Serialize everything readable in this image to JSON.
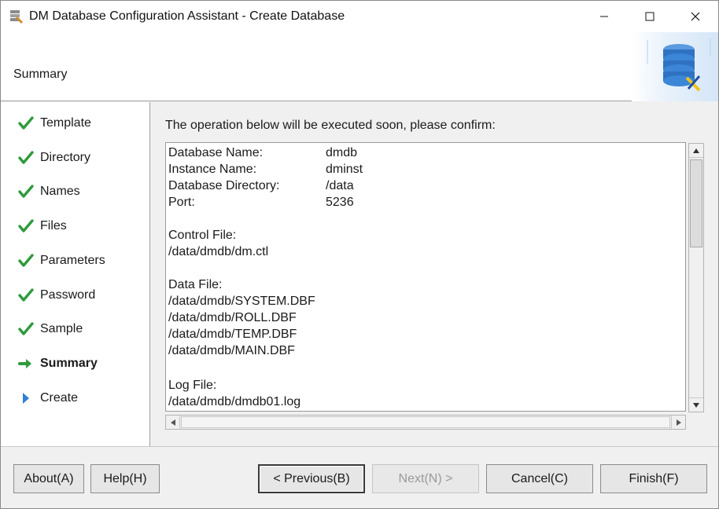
{
  "window": {
    "title": "DM Database Configuration Assistant - Create Database"
  },
  "header": {
    "title": "Summary"
  },
  "sidebar": {
    "steps": [
      {
        "label": "Template",
        "status": "done"
      },
      {
        "label": "Directory",
        "status": "done"
      },
      {
        "label": "Names",
        "status": "done"
      },
      {
        "label": "Files",
        "status": "done"
      },
      {
        "label": "Parameters",
        "status": "done"
      },
      {
        "label": "Password",
        "status": "done"
      },
      {
        "label": "Sample",
        "status": "done"
      },
      {
        "label": "Summary",
        "status": "current"
      },
      {
        "label": "Create",
        "status": "pending"
      }
    ]
  },
  "main": {
    "prompt": "The operation below will be executed soon, please confirm:",
    "summary": {
      "db_name_label": "Database Name:",
      "db_name_value": "dmdb",
      "instance_label": "Instance Name:",
      "instance_value": "dminst",
      "dir_label": "Database Directory:",
      "dir_value": "/data",
      "port_label": "Port:",
      "port_value": "5236",
      "control_file_label": "Control File:",
      "control_file_path": "/data/dmdb/dm.ctl",
      "data_file_label": "Data File:",
      "data_files": [
        "/data/dmdb/SYSTEM.DBF",
        "/data/dmdb/ROLL.DBF",
        "/data/dmdb/TEMP.DBF",
        "/data/dmdb/MAIN.DBF"
      ],
      "log_file_label": "Log File:",
      "log_file_path": "/data/dmdb/dmdb01.log"
    }
  },
  "footer": {
    "about": "About(A)",
    "help": "Help(H)",
    "previous": "< Previous(B)",
    "next": "Next(N) >",
    "cancel": "Cancel(C)",
    "finish": "Finish(F)"
  },
  "colors": {
    "check_green": "#2e9b3c",
    "arrow_green": "#2e9b3c",
    "pending_blue": "#2f7fd6"
  },
  "icons": {
    "done": "check-icon",
    "current": "arrow-right-icon",
    "pending": "triangle-right-icon"
  }
}
